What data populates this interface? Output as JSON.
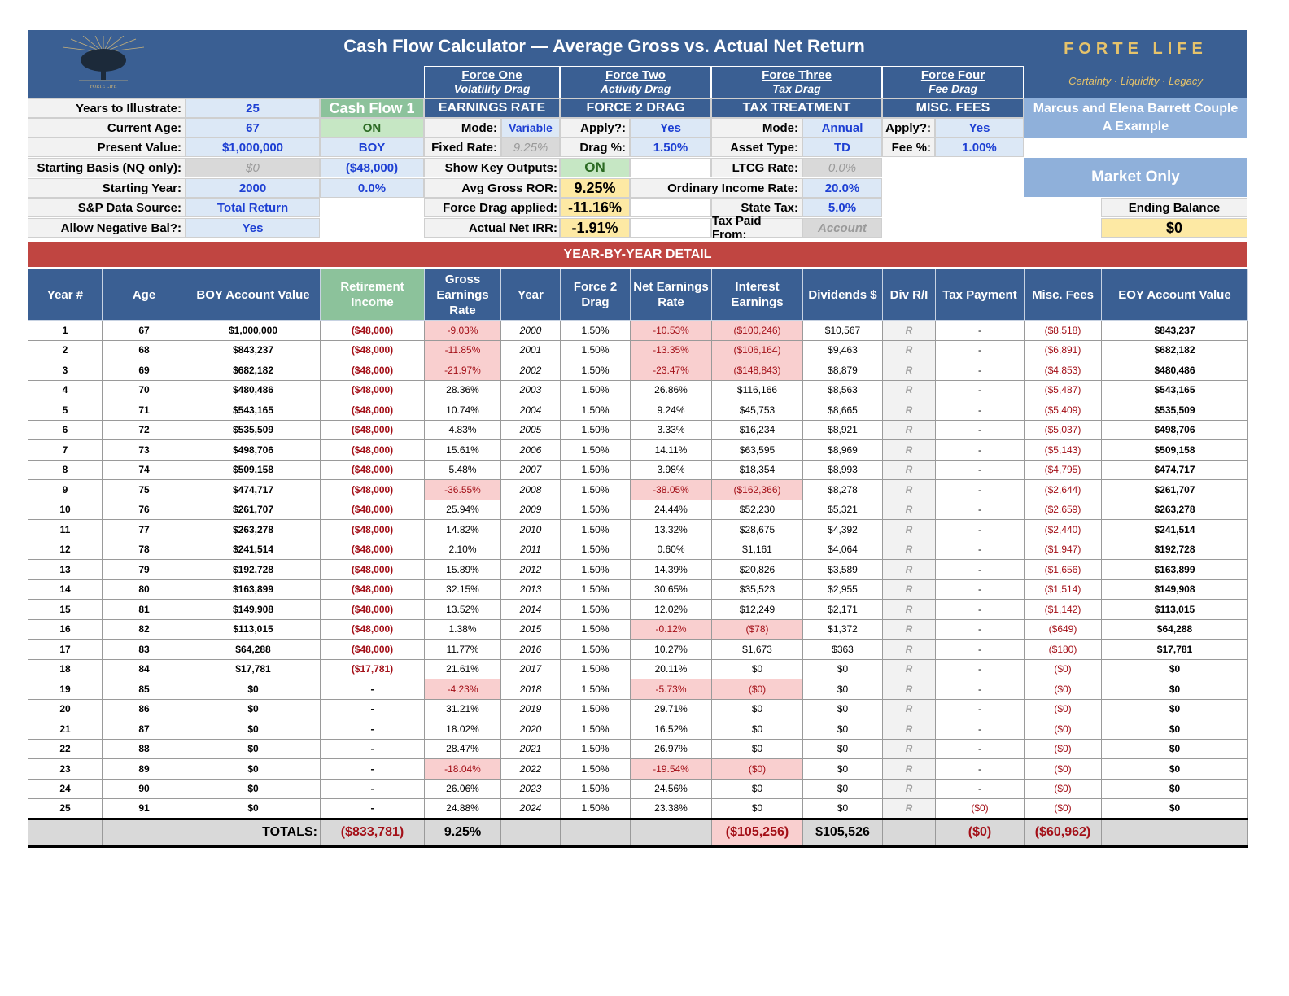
{
  "header": {
    "title": "Cash Flow Calculator — Average Gross vs. Actual Net Return",
    "logo_text": "FORTE LIFE",
    "brand": "FORTE LIFE",
    "tagline": "Certainty · Liquidity · Legacy"
  },
  "forces": [
    {
      "name": "Force One",
      "sub": "Volatility Drag",
      "section": "EARNINGS RATE"
    },
    {
      "name": "Force Two",
      "sub": "Activity Drag",
      "section": "FORCE 2 DRAG"
    },
    {
      "name": "Force Three",
      "sub": "Tax Drag",
      "section": "TAX TREATMENT"
    },
    {
      "name": "Force Four",
      "sub": "Fee Drag",
      "section": "MISC. FEES"
    }
  ],
  "inputs": {
    "years_label": "Years to Illustrate:",
    "years": "25",
    "age_label": "Current Age:",
    "age": "67",
    "pv_label": "Present Value:",
    "pv": "$1,000,000",
    "basis_label": "Starting Basis (NQ only):",
    "basis": "$0",
    "start_label": "Starting Year:",
    "start": "2000",
    "sp_label": "S&P Data Source:",
    "sp": "Total Return",
    "neg_label": "Allow Negative Bal?:",
    "neg": "Yes"
  },
  "cashflow": {
    "title": "Cash Flow 1",
    "status": "ON",
    "timing": "BOY",
    "amount": "($48,000)",
    "rate": "0.0%"
  },
  "earnings": {
    "mode_label": "Mode:",
    "mode": "Variable",
    "fixed_label": "Fixed Rate:",
    "fixed": "9.25%",
    "show_label": "Show Key Outputs:",
    "show": "ON",
    "avg_label": "Avg Gross ROR:",
    "avg": "9.25%",
    "drag_label": "Force Drag applied:",
    "drag": "-11.16%",
    "irr_label": "Actual Net IRR:",
    "irr": "-1.91%"
  },
  "force2": {
    "apply_label": "Apply?:",
    "apply": "Yes",
    "drag_label": "Drag %:",
    "drag": "1.50%"
  },
  "tax": {
    "mode_label": "Mode:",
    "mode": "Annual",
    "asset_label": "Asset Type:",
    "asset": "TD",
    "ltcg_label": "LTCG Rate:",
    "ltcg": "0.0%",
    "oi_label": "Ordinary Income Rate:",
    "oi": "20.0%",
    "state_label": "State Tax:",
    "state": "5.0%",
    "paid_label": "Tax Paid From:",
    "paid": "Account"
  },
  "fees": {
    "apply_label": "Apply?:",
    "apply": "Yes",
    "fee_label": "Fee %:",
    "fee": "1.00%"
  },
  "client": {
    "line1": "Marcus and Elena Barrett Couple",
    "line2": "A Example",
    "scenario": "Market Only",
    "ending_label": "Ending Balance",
    "ending": "$0"
  },
  "band": "YEAR-BY-YEAR DETAIL",
  "columns": [
    "Year #",
    "Age",
    "BOY Account Value",
    "Retirement Income",
    "Gross Earnings Rate",
    "Year",
    "Force 2 Drag",
    "Net Earnings Rate",
    "Interest Earnings",
    "Dividends $",
    "Div R/I",
    "Tax Payment",
    "Misc. Fees",
    "EOY Account Value"
  ],
  "rows": [
    [
      "1",
      "67",
      "$1,000,000",
      "($48,000)",
      "-9.03%",
      "2000",
      "1.50%",
      "-10.53%",
      "($100,246)",
      "$10,567",
      "R",
      "-",
      "($8,518)",
      "$843,237"
    ],
    [
      "2",
      "68",
      "$843,237",
      "($48,000)",
      "-11.85%",
      "2001",
      "1.50%",
      "-13.35%",
      "($106,164)",
      "$9,463",
      "R",
      "-",
      "($6,891)",
      "$682,182"
    ],
    [
      "3",
      "69",
      "$682,182",
      "($48,000)",
      "-21.97%",
      "2002",
      "1.50%",
      "-23.47%",
      "($148,843)",
      "$8,879",
      "R",
      "-",
      "($4,853)",
      "$480,486"
    ],
    [
      "4",
      "70",
      "$480,486",
      "($48,000)",
      "28.36%",
      "2003",
      "1.50%",
      "26.86%",
      "$116,166",
      "$8,563",
      "R",
      "-",
      "($5,487)",
      "$543,165"
    ],
    [
      "5",
      "71",
      "$543,165",
      "($48,000)",
      "10.74%",
      "2004",
      "1.50%",
      "9.24%",
      "$45,753",
      "$8,665",
      "R",
      "-",
      "($5,409)",
      "$535,509"
    ],
    [
      "6",
      "72",
      "$535,509",
      "($48,000)",
      "4.83%",
      "2005",
      "1.50%",
      "3.33%",
      "$16,234",
      "$8,921",
      "R",
      "-",
      "($5,037)",
      "$498,706"
    ],
    [
      "7",
      "73",
      "$498,706",
      "($48,000)",
      "15.61%",
      "2006",
      "1.50%",
      "14.11%",
      "$63,595",
      "$8,969",
      "R",
      "-",
      "($5,143)",
      "$509,158"
    ],
    [
      "8",
      "74",
      "$509,158",
      "($48,000)",
      "5.48%",
      "2007",
      "1.50%",
      "3.98%",
      "$18,354",
      "$8,993",
      "R",
      "-",
      "($4,795)",
      "$474,717"
    ],
    [
      "9",
      "75",
      "$474,717",
      "($48,000)",
      "-36.55%",
      "2008",
      "1.50%",
      "-38.05%",
      "($162,366)",
      "$8,278",
      "R",
      "-",
      "($2,644)",
      "$261,707"
    ],
    [
      "10",
      "76",
      "$261,707",
      "($48,000)",
      "25.94%",
      "2009",
      "1.50%",
      "24.44%",
      "$52,230",
      "$5,321",
      "R",
      "-",
      "($2,659)",
      "$263,278"
    ],
    [
      "11",
      "77",
      "$263,278",
      "($48,000)",
      "14.82%",
      "2010",
      "1.50%",
      "13.32%",
      "$28,675",
      "$4,392",
      "R",
      "-",
      "($2,440)",
      "$241,514"
    ],
    [
      "12",
      "78",
      "$241,514",
      "($48,000)",
      "2.10%",
      "2011",
      "1.50%",
      "0.60%",
      "$1,161",
      "$4,064",
      "R",
      "-",
      "($1,947)",
      "$192,728"
    ],
    [
      "13",
      "79",
      "$192,728",
      "($48,000)",
      "15.89%",
      "2012",
      "1.50%",
      "14.39%",
      "$20,826",
      "$3,589",
      "R",
      "-",
      "($1,656)",
      "$163,899"
    ],
    [
      "14",
      "80",
      "$163,899",
      "($48,000)",
      "32.15%",
      "2013",
      "1.50%",
      "30.65%",
      "$35,523",
      "$2,955",
      "R",
      "-",
      "($1,514)",
      "$149,908"
    ],
    [
      "15",
      "81",
      "$149,908",
      "($48,000)",
      "13.52%",
      "2014",
      "1.50%",
      "12.02%",
      "$12,249",
      "$2,171",
      "R",
      "-",
      "($1,142)",
      "$113,015"
    ],
    [
      "16",
      "82",
      "$113,015",
      "($48,000)",
      "1.38%",
      "2015",
      "1.50%",
      "-0.12%",
      "($78)",
      "$1,372",
      "R",
      "-",
      "($649)",
      "$64,288"
    ],
    [
      "17",
      "83",
      "$64,288",
      "($48,000)",
      "11.77%",
      "2016",
      "1.50%",
      "10.27%",
      "$1,673",
      "$363",
      "R",
      "-",
      "($180)",
      "$17,781"
    ],
    [
      "18",
      "84",
      "$17,781",
      "($17,781)",
      "21.61%",
      "2017",
      "1.50%",
      "20.11%",
      "$0",
      "$0",
      "R",
      "-",
      "($0)",
      "$0"
    ],
    [
      "19",
      "85",
      "$0",
      "-",
      "-4.23%",
      "2018",
      "1.50%",
      "-5.73%",
      "($0)",
      "$0",
      "R",
      "-",
      "($0)",
      "$0"
    ],
    [
      "20",
      "86",
      "$0",
      "-",
      "31.21%",
      "2019",
      "1.50%",
      "29.71%",
      "$0",
      "$0",
      "R",
      "-",
      "($0)",
      "$0"
    ],
    [
      "21",
      "87",
      "$0",
      "-",
      "18.02%",
      "2020",
      "1.50%",
      "16.52%",
      "$0",
      "$0",
      "R",
      "-",
      "($0)",
      "$0"
    ],
    [
      "22",
      "88",
      "$0",
      "-",
      "28.47%",
      "2021",
      "1.50%",
      "26.97%",
      "$0",
      "$0",
      "R",
      "-",
      "($0)",
      "$0"
    ],
    [
      "23",
      "89",
      "$0",
      "-",
      "-18.04%",
      "2022",
      "1.50%",
      "-19.54%",
      "($0)",
      "$0",
      "R",
      "-",
      "($0)",
      "$0"
    ],
    [
      "24",
      "90",
      "$0",
      "-",
      "26.06%",
      "2023",
      "1.50%",
      "24.56%",
      "$0",
      "$0",
      "R",
      "-",
      "($0)",
      "$0"
    ],
    [
      "25",
      "91",
      "$0",
      "-",
      "24.88%",
      "2024",
      "1.50%",
      "23.38%",
      "$0",
      "$0",
      "R",
      "($0)",
      "($0)",
      "$0"
    ]
  ],
  "totals": {
    "label": "TOTALS:",
    "income": "($833,781)",
    "gross": "9.25%",
    "interest": "($105,256)",
    "dividends": "$105,526",
    "tax": "($0)",
    "fees": "($60,962)"
  }
}
